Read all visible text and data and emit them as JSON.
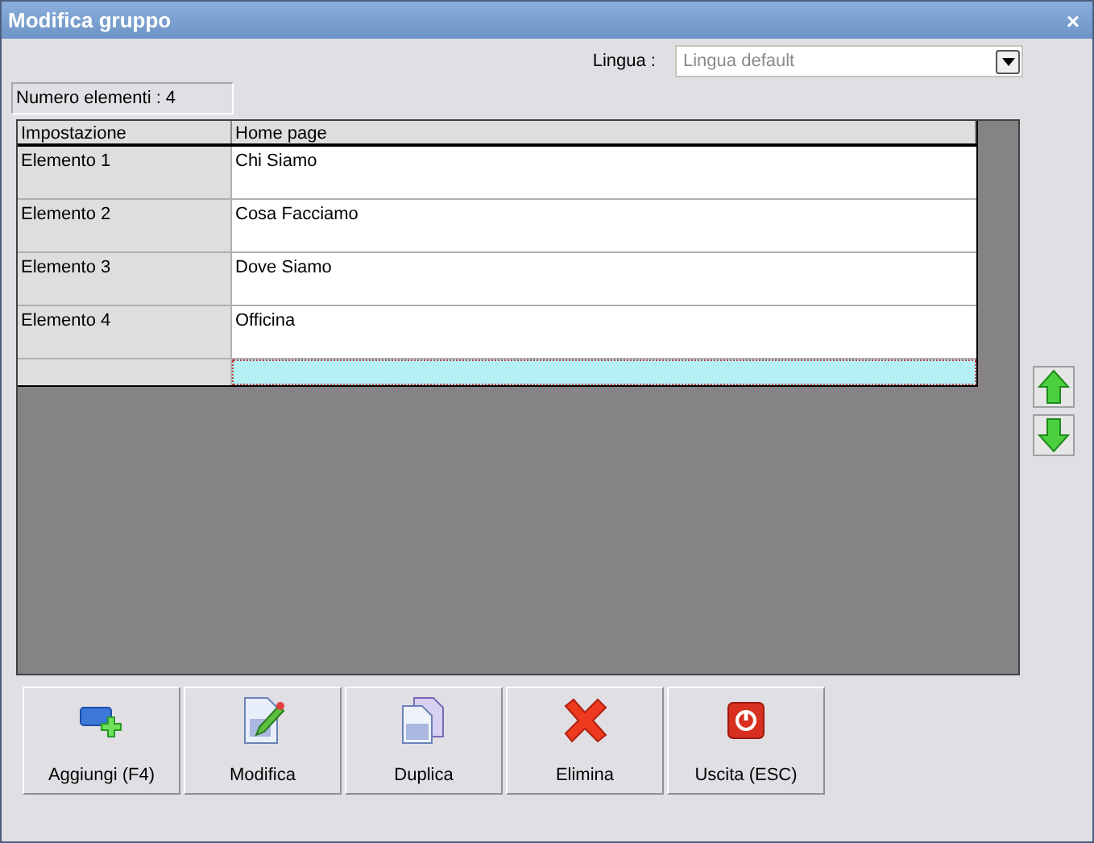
{
  "window": {
    "title": "Modifica gruppo",
    "close": "×"
  },
  "language": {
    "label": "Lingua :",
    "placeholder": "Lingua default"
  },
  "count": "Numero elementi : 4",
  "table": {
    "columns": [
      "Impostazione",
      "Home page"
    ],
    "rows": [
      {
        "name": "Elemento 1",
        "value": "Chi Siamo"
      },
      {
        "name": "Elemento 2",
        "value": "Cosa Facciamo"
      },
      {
        "name": "Elemento 3",
        "value": "Dove Siamo"
      },
      {
        "name": "Elemento 4",
        "value": "Officina"
      }
    ],
    "new_row": {
      "selected": true
    }
  },
  "buttons": [
    {
      "label": "Aggiungi (F4)",
      "kind": "add"
    },
    {
      "label": "Modifica",
      "kind": "edit"
    },
    {
      "label": "Duplica",
      "kind": "duplicate"
    },
    {
      "label": "Elimina",
      "kind": "delete"
    },
    {
      "label": "Uscita (ESC)",
      "kind": "exit"
    }
  ]
}
